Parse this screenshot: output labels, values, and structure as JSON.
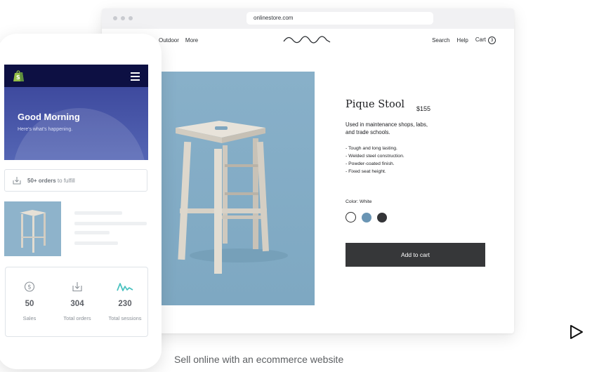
{
  "browser": {
    "url": "onlinestore.com"
  },
  "store": {
    "nav_left": [
      "Outdoor",
      "More"
    ],
    "nav_right": {
      "search": "Search",
      "help": "Help",
      "cart": "Cart",
      "cart_count": "3"
    },
    "logo_icon": "wave-logo-icon"
  },
  "product": {
    "title": "Pique Stool",
    "price": "$155",
    "description": "Used in maintenance shops, labs, and trade schools.",
    "features": [
      "- Tough and long lasting.",
      "- Welded steel construction.",
      "- Powder-coated finish.",
      "- Fixed seat height."
    ],
    "color_label": "Color: White",
    "swatches": [
      {
        "name": "White",
        "hex": "#ffffff",
        "selected": true
      },
      {
        "name": "Blue",
        "hex": "#6a95b4",
        "selected": false
      },
      {
        "name": "Black",
        "hex": "#343538",
        "selected": false
      }
    ],
    "add_to_cart": "Add to cart",
    "image_bg": "#8eb3cb"
  },
  "mobile_app": {
    "header_bg": "#0d1043",
    "greeting": "Good Morning",
    "subtitle": "Here's what's happening.",
    "orders_count": "50+ orders",
    "orders_suffix": " to fulfill",
    "stats": [
      {
        "icon": "dollar-icon",
        "value": "50",
        "label": "Sales"
      },
      {
        "icon": "orders-download-icon",
        "value": "304",
        "label": "Total orders"
      },
      {
        "icon": "sessions-wave-icon",
        "value": "230",
        "label": "Total sessions"
      }
    ]
  },
  "caption": "Sell online with an ecommerce website",
  "colors": {
    "accent_teal": "#47c1bf",
    "button_dark": "#363739",
    "hero_blue": "#4a57aa"
  }
}
